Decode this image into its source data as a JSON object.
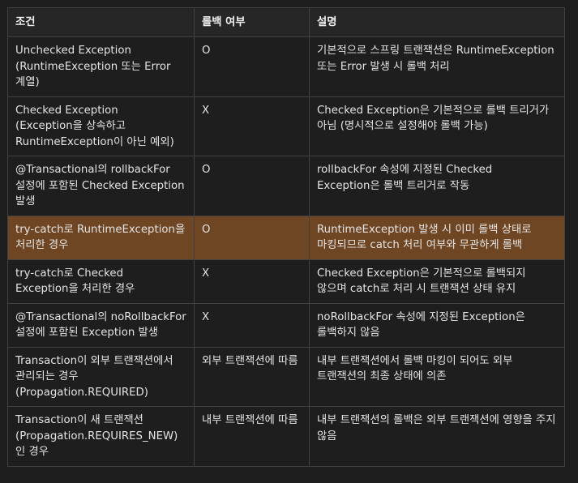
{
  "table": {
    "headers": [
      "조건",
      "롤백 여부",
      "설명"
    ],
    "rows": [
      {
        "condition": "Unchecked Exception (RuntimeException 또는 Error 계열)",
        "rollback": "O",
        "description": "기본적으로 스프링 트랜잭션은 RuntimeException 또는 Error 발생 시 롤백 처리",
        "highlighted": false
      },
      {
        "condition": "Checked Exception (Exception을 상속하고 RuntimeException이 아닌 예외)",
        "rollback": "X",
        "description": "Checked Exception은 기본적으로 롤백 트리거가 아님 (명시적으로 설정해야 롤백 가능)",
        "highlighted": false
      },
      {
        "condition": "@Transactional의 rollbackFor 설정에 포함된 Checked Exception 발생",
        "rollback": "O",
        "description": "rollbackFor 속성에 지정된 Checked Exception은 롤백 트리거로 작동",
        "highlighted": false
      },
      {
        "condition": "try-catch로 RuntimeException을 처리한 경우",
        "rollback": "O",
        "description": "RuntimeException 발생 시 이미 롤백 상태로 마킹되므로 catch 처리 여부와 무관하게 롤백",
        "highlighted": true
      },
      {
        "condition": "try-catch로 Checked Exception을 처리한 경우",
        "rollback": "X",
        "description": "Checked Exception은 기본적으로 롤백되지 않으며 catch로 처리 시 트랜잭션 상태 유지",
        "highlighted": false
      },
      {
        "condition": "@Transactional의 noRollbackFor 설정에 포함된 Exception 발생",
        "rollback": "X",
        "description": "noRollbackFor 속성에 지정된 Exception은 롤백하지 않음",
        "highlighted": false
      },
      {
        "condition": "Transaction이 외부 트랜잭션에서 관리되는 경우 (Propagation.REQUIRED)",
        "rollback": "외부 트랜잭션에 따름",
        "description": "내부 트랜잭션에서 롤백 마킹이 되어도 외부 트랜잭션의 최종 상태에 의존",
        "highlighted": false
      },
      {
        "condition": "Transaction이 새 트랜잭션 (Propagation.REQUIRES_NEW)인 경우",
        "rollback": "내부 트랜잭션에 따름",
        "description": "내부 트랜잭션의 롤백은 외부 트랜잭션에 영향을 주지 않음",
        "highlighted": false
      }
    ]
  }
}
